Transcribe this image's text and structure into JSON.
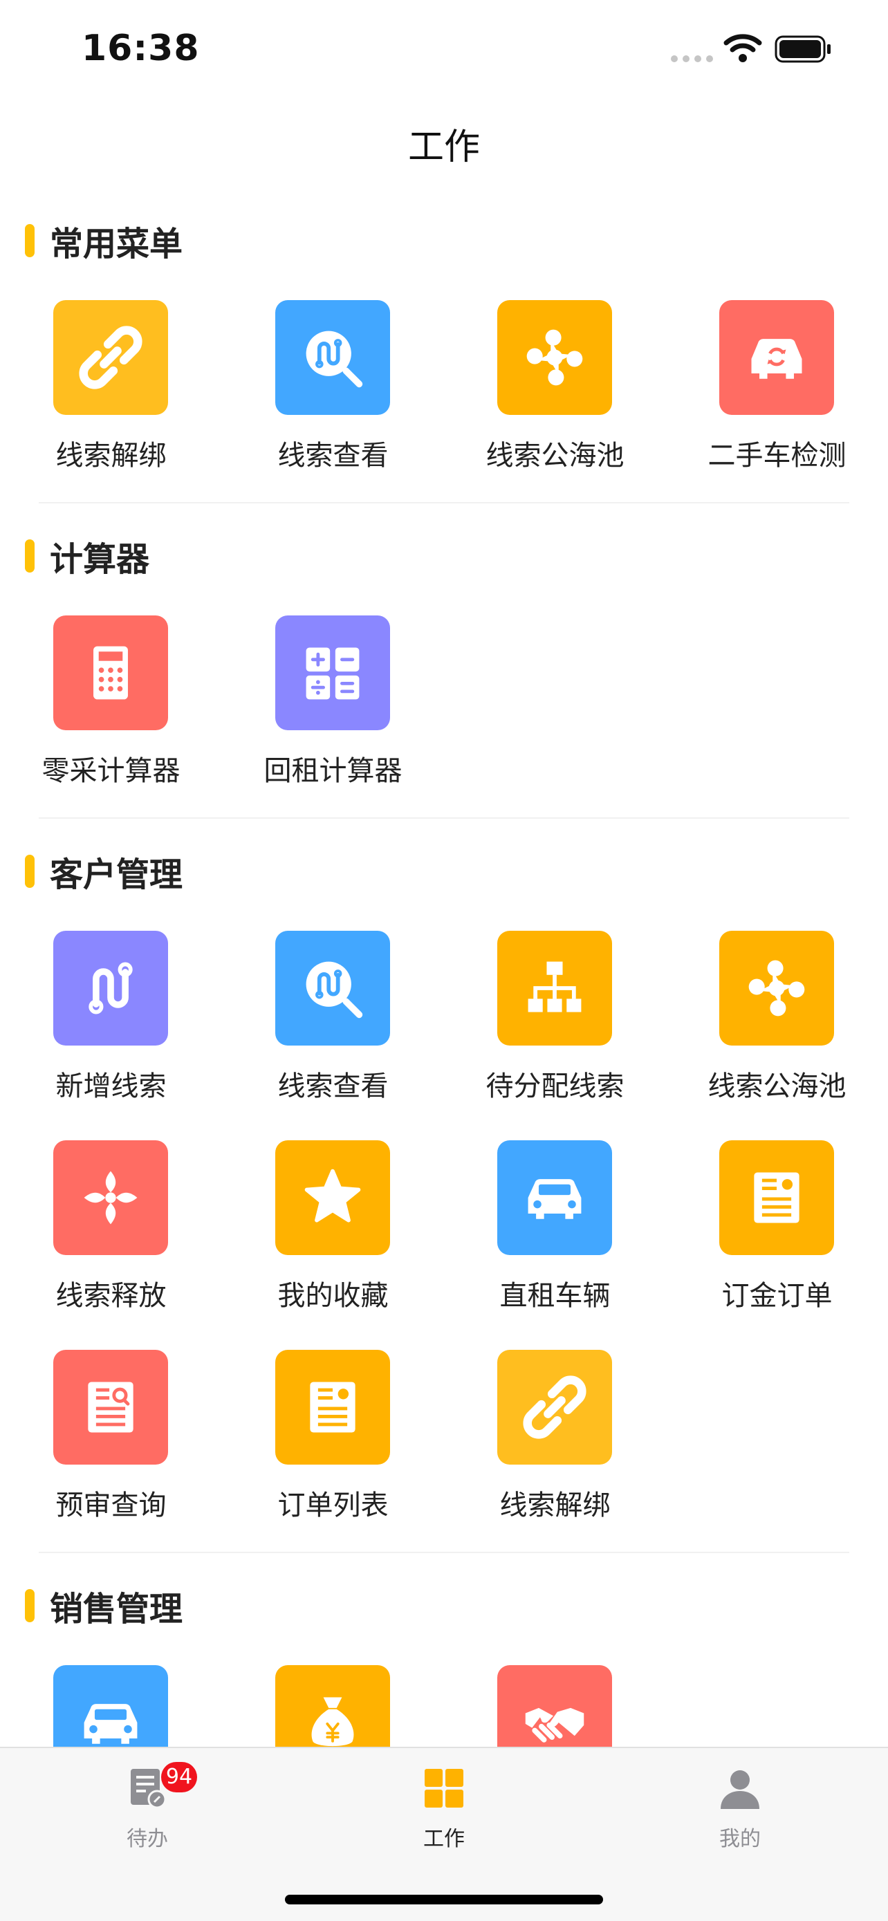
{
  "status_bar": {
    "time": "16:38"
  },
  "nav": {
    "title": "工作"
  },
  "sections": {
    "common": {
      "title": "常用菜单",
      "items": [
        {
          "label": "线索解绑",
          "icon": "link-icon",
          "color": "#FFBE1F"
        },
        {
          "label": "线索查看",
          "icon": "route-search-icon",
          "color": "#42A7FF"
        },
        {
          "label": "线索公海池",
          "icon": "nodes-icon",
          "color": "#FFB200"
        },
        {
          "label": "二手车检测",
          "icon": "car-check-icon",
          "color": "#FF6C63"
        }
      ]
    },
    "calculator": {
      "title": "计算器",
      "items": [
        {
          "label": "零采计算器",
          "icon": "calculator-icon",
          "color": "#FF6C63"
        },
        {
          "label": "回租计算器",
          "icon": "math-ops-icon",
          "color": "#8A87FF"
        }
      ]
    },
    "customer": {
      "title": "客户管理",
      "items": [
        {
          "label": "新增线索",
          "icon": "route-icon",
          "color": "#8A87FF"
        },
        {
          "label": "线索查看",
          "icon": "route-search-icon",
          "color": "#42A7FF"
        },
        {
          "label": "待分配线索",
          "icon": "org-chart-icon",
          "color": "#FFB200"
        },
        {
          "label": "线索公海池",
          "icon": "nodes-icon",
          "color": "#FFB200"
        },
        {
          "label": "线索释放",
          "icon": "release-icon",
          "color": "#FF6C63"
        },
        {
          "label": "我的收藏",
          "icon": "star-icon",
          "color": "#FFB200"
        },
        {
          "label": "直租车辆",
          "icon": "car-icon",
          "color": "#42A7FF"
        },
        {
          "label": "订金订单",
          "icon": "document-icon",
          "color": "#FFB200"
        },
        {
          "label": "预审查询",
          "icon": "document-search-icon",
          "color": "#FF6C63"
        },
        {
          "label": "订单列表",
          "icon": "document-icon",
          "color": "#FFB200"
        },
        {
          "label": "线索解绑",
          "icon": "link-icon",
          "color": "#FFBE1F"
        }
      ]
    },
    "sales": {
      "title": "销售管理",
      "items": [
        {
          "label": "",
          "icon": "car-icon",
          "color": "#42A7FF"
        },
        {
          "label": "",
          "icon": "money-bag-icon",
          "color": "#FFB200"
        },
        {
          "label": "",
          "icon": "handshake-icon",
          "color": "#FF6C63"
        }
      ]
    }
  },
  "tab_bar": {
    "tabs": [
      {
        "label": "待办",
        "icon": "todo-icon",
        "badge": "94"
      },
      {
        "label": "工作",
        "icon": "grid-icon",
        "active": true
      },
      {
        "label": "我的",
        "icon": "user-icon"
      }
    ]
  },
  "colors": {
    "accent": "#FFC107",
    "badge": "#F0141E"
  }
}
